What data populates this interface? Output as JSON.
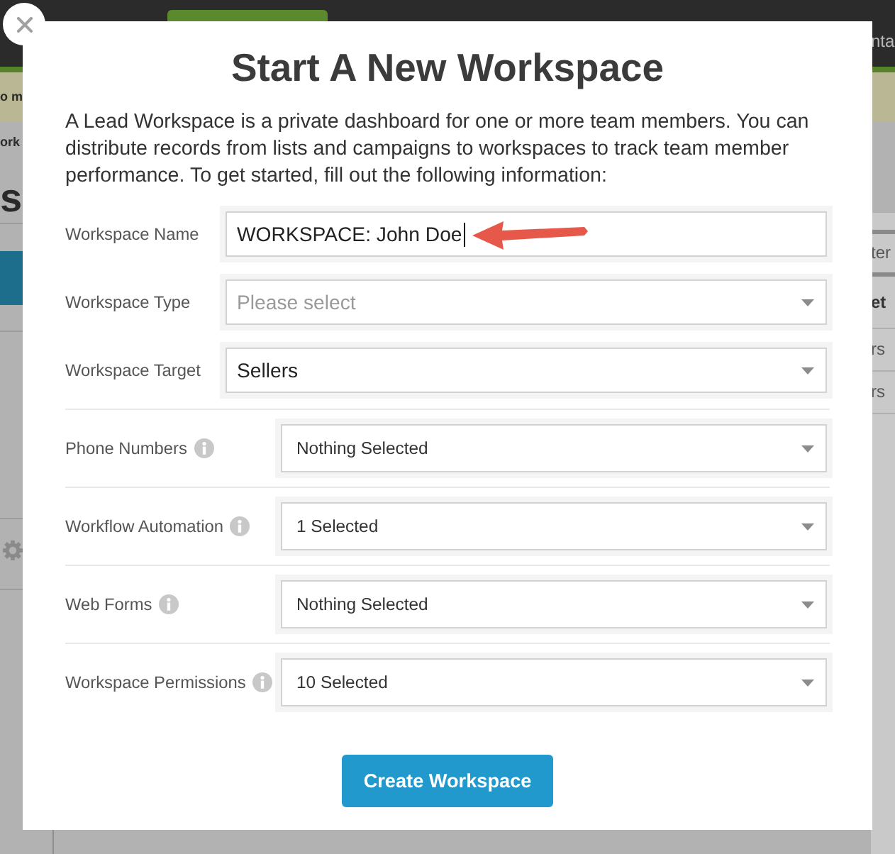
{
  "background": {
    "top_bar": {
      "text": "nta"
    },
    "banner": {
      "text": "o m"
    },
    "left_panel": {
      "breadcrumb": "ork",
      "heading": "s"
    },
    "right_table": {
      "header": "ter",
      "column_heading": "et",
      "cells": [
        "rs",
        "rs"
      ]
    }
  },
  "modal": {
    "title": "Start A New Workspace",
    "description": "A Lead Workspace is a private dashboard for one or more team members. You can distribute records from lists and campaigns to workspaces to track team member performance. To get started, fill out the following information:",
    "fields": [
      {
        "kind": "text",
        "label": "Workspace Name",
        "value": "WORKSPACE: John Doe",
        "info": false,
        "focused": true
      },
      {
        "kind": "select",
        "label": "Workspace Type",
        "placeholder": "Please select",
        "info": false,
        "focused": false
      },
      {
        "kind": "select",
        "label": "Workspace Target",
        "value": "Sellers",
        "info": false,
        "focused": false
      },
      {
        "kind": "multiselect",
        "label": "Phone Numbers",
        "value": "Nothing Selected",
        "info": true,
        "focused": false
      },
      {
        "kind": "multiselect",
        "label": "Workflow Automation",
        "value": "1 Selected",
        "info": true,
        "focused": false
      },
      {
        "kind": "multiselect",
        "label": "Web Forms",
        "value": "Nothing Selected",
        "info": true,
        "focused": false
      },
      {
        "kind": "multiselect",
        "label": "Workspace Permissions",
        "value": "10 Selected",
        "info": true,
        "focused": false
      }
    ],
    "submit_button": "Create Workspace"
  }
}
